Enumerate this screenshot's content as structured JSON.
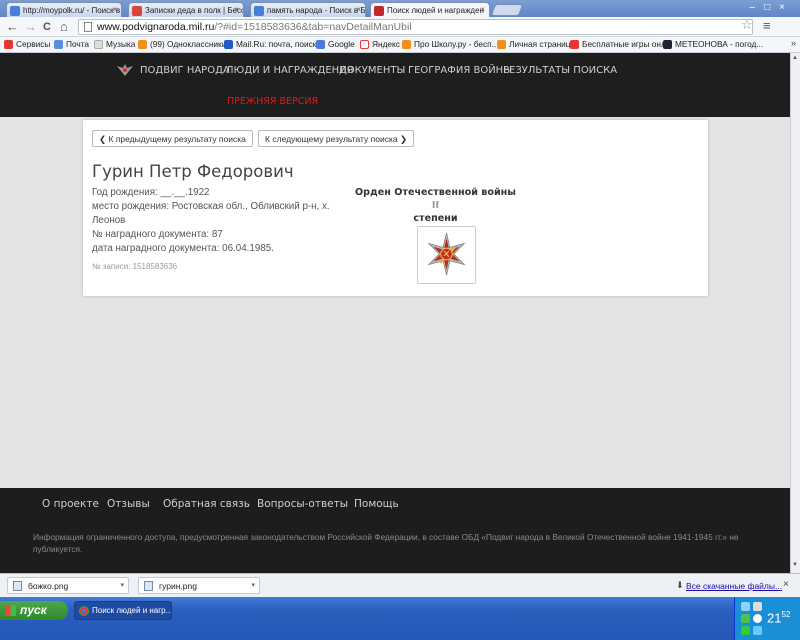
{
  "browser": {
    "tabs": [
      {
        "label": "http://moypolk.ru/ - Поиск в",
        "color": "#4a7cd9"
      },
      {
        "label": "Записки деда в полк | Бесс",
        "color": "#d8463a"
      },
      {
        "label": "память народа - Поиск в Б",
        "color": "#4a7cd9"
      },
      {
        "label": "Поиск людей и награжден",
        "color": "#c0282a"
      }
    ],
    "tab_close": "×",
    "window_controls": "–□×",
    "url_host": "www.podvignaroda.mil.ru",
    "url_path": "/?#id=1518583636&tab=navDetailManUbil",
    "nav_back": "←",
    "nav_forward": "→",
    "nav_reload": "C",
    "nav_home": "⌂",
    "star": "☆",
    "wrench": "≡",
    "bookmarks": [
      {
        "label": "Сервисы",
        "color": "#e33"
      },
      {
        "label": "Почта",
        "color": "#5a8de0"
      },
      {
        "label": "Музыка",
        "color": "#ddd"
      },
      {
        "label": "(99) Одноклассники",
        "color": "#f39016"
      },
      {
        "label": "Mail.Ru: почта, поиск ...",
        "color": "#1f5bc7"
      },
      {
        "label": "Google",
        "color": "#4a7cd9"
      },
      {
        "label": "Яндекс",
        "color": "#e33"
      },
      {
        "label": "Про Школу.ру - бесп...",
        "color": "#f39016"
      },
      {
        "label": "Личная страница",
        "color": "#f39016"
      },
      {
        "label": "Бесплатные игры онл...",
        "color": "#e33"
      },
      {
        "label": "МЕТЕОНОВА - погод...",
        "color": "#223"
      }
    ],
    "bookmarks_more": "»"
  },
  "site": {
    "nav": [
      "ПОДВИГ НАРОДА",
      "ЛЮДИ И НАГРАЖДЕНИЯ",
      "ДОКУМЕНТЫ",
      "ГЕОГРАФИЯ ВОЙНЫ",
      "РЕЗУЛЬТАТЫ ПОИСКА"
    ],
    "old_version": "ПРЕЖНЯЯ ВЕРСИЯ"
  },
  "record": {
    "prev_label": "К предыдущему результату поиска",
    "next_label": "К следующему результату поиска",
    "prev_icon": "❮",
    "next_icon": "❯",
    "name": "Гурин Петр Федорович",
    "birth_year": "Год рождения: __.__.1922",
    "birth_place_1": "место рождения: Ростовская обл., Обливский р-н, х.",
    "birth_place_2": "Леонов",
    "doc_number": "№ наградного документа: 87",
    "doc_date": "дата наградного документа: 06.04.1985.",
    "record_id": "№ записи: 1518583636",
    "award_title": "Орден Отечественной войны",
    "award_grade": "II",
    "award_line2": "степени"
  },
  "footer": {
    "links": [
      "О проекте",
      "Отзывы",
      "Обратная связь",
      "Вопросы-ответы",
      "Помощь"
    ],
    "notice": "Информация ограниченного доступа, предусмотренная законодательством Российской Федерации, в составе ОБД «Подвиг народа в Великой Отечественной войне 1941-1945 гг.» не публикуется."
  },
  "downloads": {
    "files": [
      "божко.png",
      "гурин.png"
    ],
    "all_label": "Все скачанные файлы...",
    "close": "×",
    "caret": "▾"
  },
  "taskbar": {
    "start_label": "пуск",
    "window_label": "Поиск людей и нагр...",
    "clock_hour": "21",
    "clock_min": "52"
  }
}
